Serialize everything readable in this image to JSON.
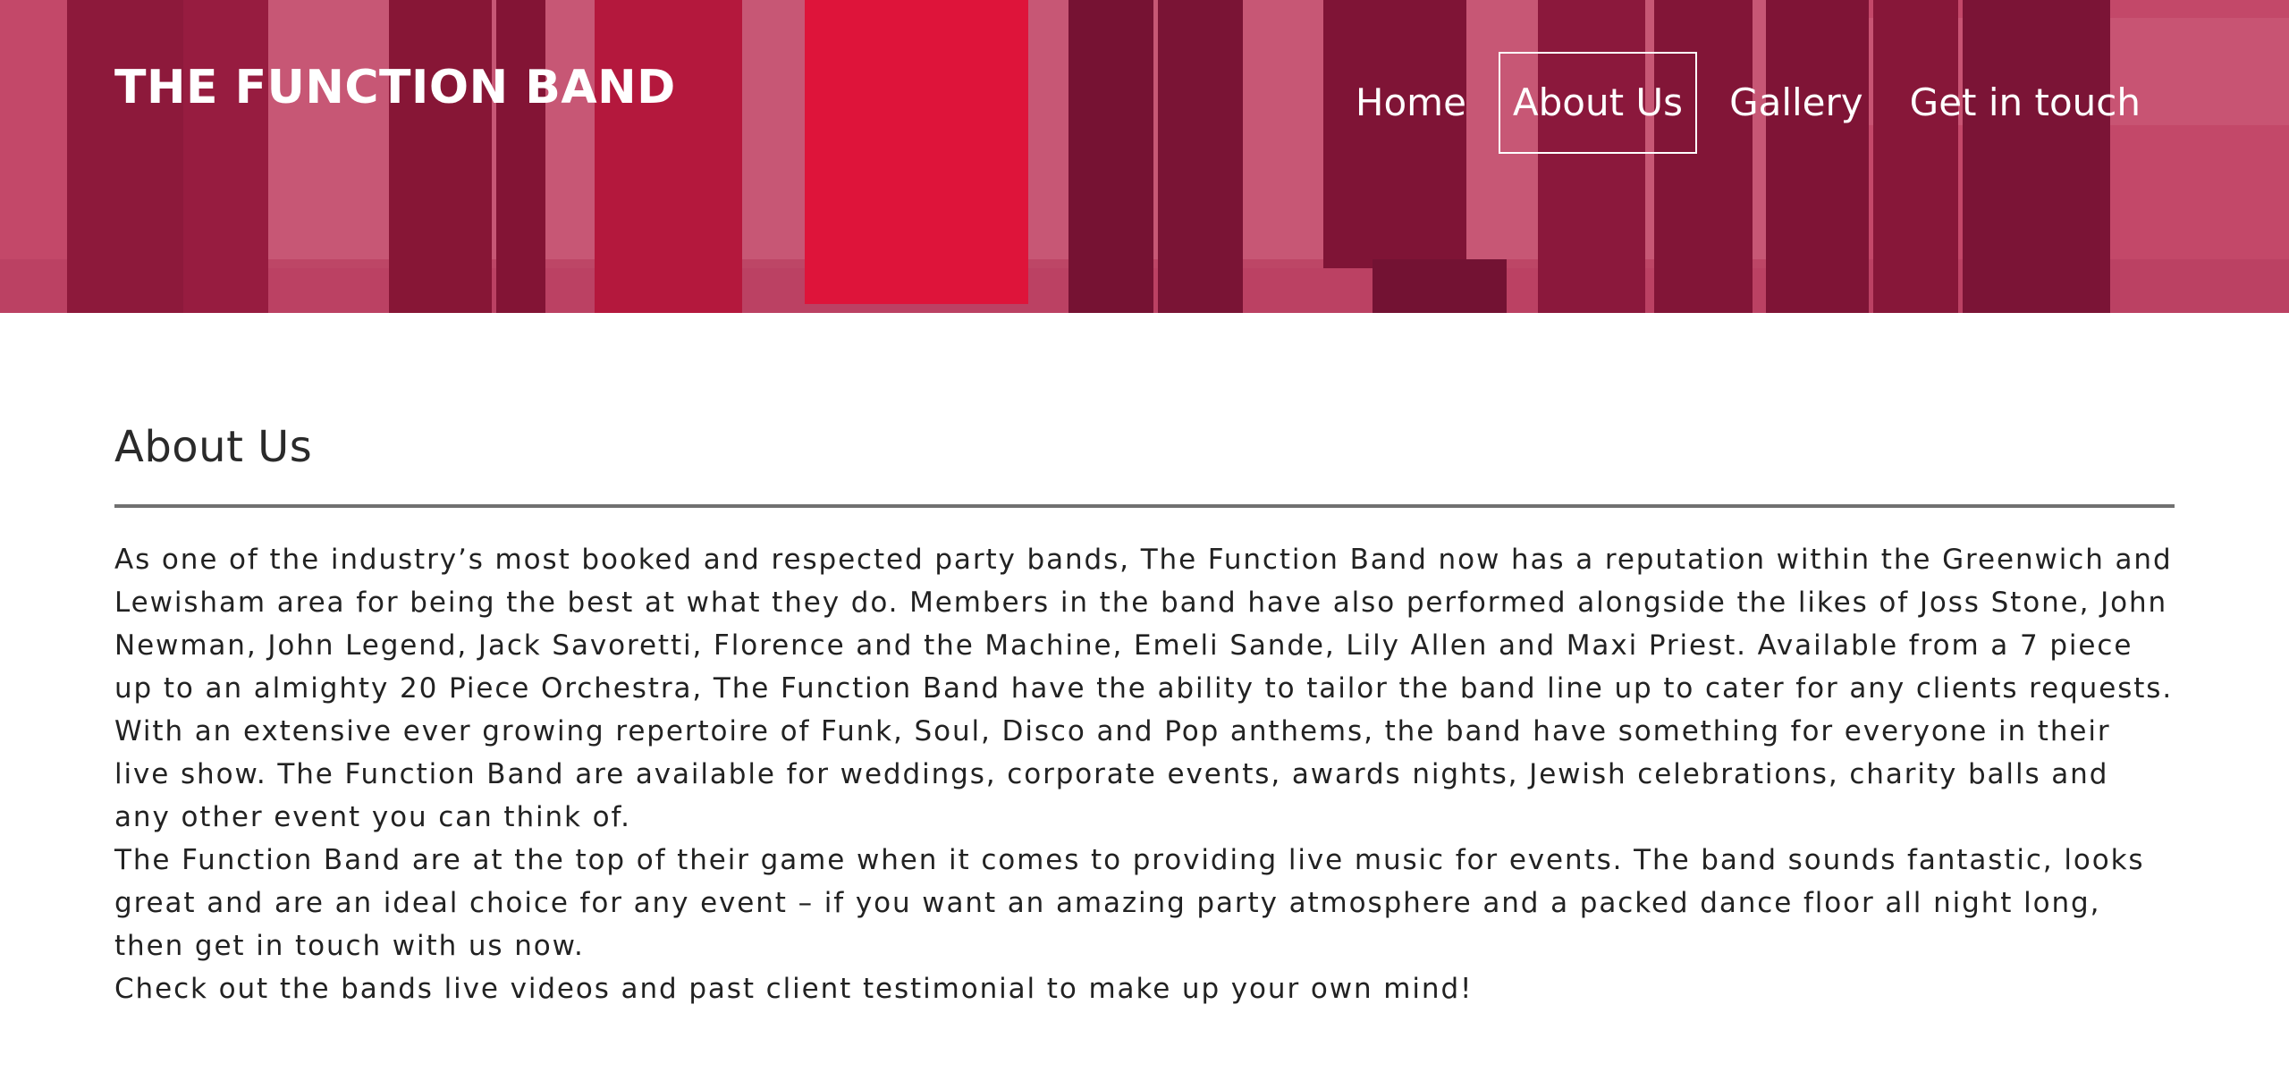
{
  "header": {
    "brand": "THE FUNCTION BAND",
    "nav": [
      {
        "label": "Home"
      },
      {
        "label": "About Us"
      },
      {
        "label": "Gallery"
      },
      {
        "label": "Get in touch"
      }
    ],
    "active": "About Us"
  },
  "main": {
    "title": "About Us",
    "paragraphs": [
      "As one of the industry’s most booked and respected party bands, The Function Band now has a reputation within the Greenwich and Lewisham area for being the best at what they do. Members in the band have also performed alongside the likes of Joss Stone, John Newman, John Legend, Jack Savoretti, Florence and the Machine, Emeli Sande, Lily Allen and Maxi Priest. Available from a 7 piece up to an almighty 20 Piece Orchestra, The Function Band have the ability to tailor the band line up to cater for any clients requests. With an extensive ever growing repertoire of Funk, Soul, Disco and Pop anthems, the band have something for everyone in their live show. The Function Band are available for weddings, corporate events, awards nights, Jewish celebrations, charity balls and any other event you can think of.",
      "The Function Band are at the top of their game when it comes to providing live music for events. The band sounds fantastic, looks great and are an ideal choice for any event – if you want an amazing party atmosphere and a packed dance floor all night long, then get in touch with us now.",
      "Check out the bands live videos and past client testimonial to make up your own mind!"
    ]
  },
  "colors": {
    "hero_tint": "#b8294f",
    "text": "#222222",
    "divider": "#707070"
  }
}
